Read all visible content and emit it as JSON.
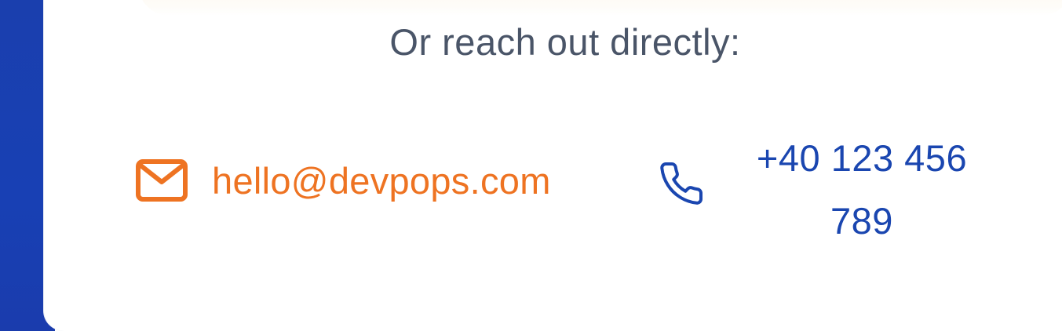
{
  "contact": {
    "heading": "Or reach out directly:",
    "email": {
      "icon": "mail-icon",
      "label": "hello@devpops.com",
      "color": "#ee7322"
    },
    "phone": {
      "icon": "phone-icon",
      "label": "+40 123 456 789",
      "color": "#1a46b0"
    }
  },
  "colors": {
    "sidebar_background": "#1a3fae",
    "card_background": "#ffffff",
    "heading_text": "#4a5568"
  }
}
